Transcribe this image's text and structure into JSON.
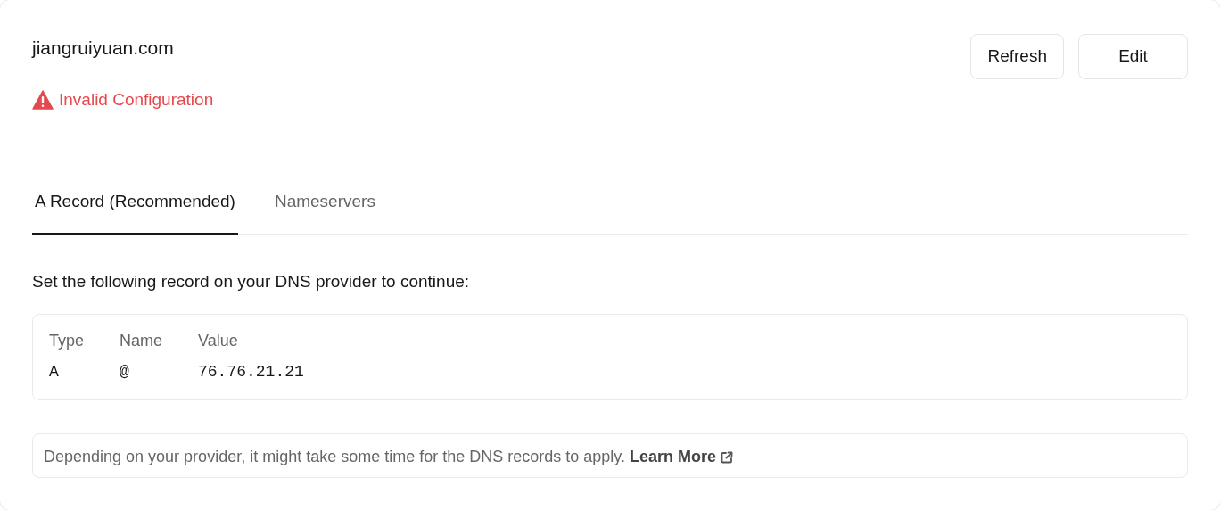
{
  "domain": "jiangruiyuan.com",
  "status": {
    "kind": "error",
    "label": "Invalid Configuration"
  },
  "buttons": [
    "Refresh",
    "Edit"
  ],
  "tabs": [
    {
      "label": "A Record (Recommended)",
      "selected": true
    },
    {
      "label": "Nameservers",
      "selected": false
    }
  ],
  "instruction": "Set the following record on your DNS provider to continue:",
  "table": {
    "columns": [
      "Type",
      "Name",
      "Value"
    ],
    "rows": [
      [
        "A",
        "@",
        "76.76.21.21"
      ]
    ]
  },
  "note": {
    "text": "Depending on your provider, it might take some time for the DNS records to apply.",
    "link": "Learn More"
  }
}
